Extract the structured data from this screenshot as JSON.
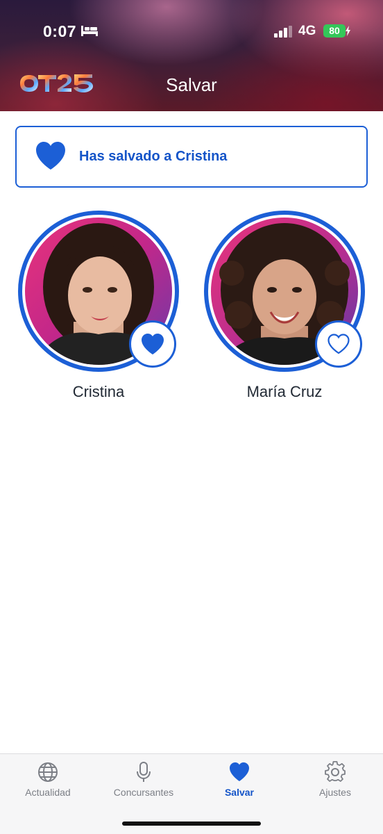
{
  "status_bar": {
    "time": "0:07",
    "network": "4G",
    "battery": "80",
    "icons": [
      "bed-icon",
      "cellular-signal-icon",
      "battery-charging-icon"
    ]
  },
  "header": {
    "logo_text": "OT25",
    "title": "Salvar"
  },
  "notice": {
    "icon": "heart-filled-icon",
    "text": "Has salvado a Cristina"
  },
  "contestants": [
    {
      "name": "Cristina",
      "saved": true,
      "icon": "heart-filled-icon"
    },
    {
      "name": "María Cruz",
      "saved": false,
      "icon": "heart-outline-icon"
    }
  ],
  "tabbar": {
    "tabs": [
      {
        "label": "Actualidad",
        "icon": "globe-icon",
        "active": false
      },
      {
        "label": "Concursantes",
        "icon": "microphone-icon",
        "active": false
      },
      {
        "label": "Salvar",
        "icon": "heart-filled-icon",
        "active": true
      },
      {
        "label": "Ajustes",
        "icon": "gear-icon",
        "active": false
      }
    ]
  },
  "colors": {
    "accent": "#1c5fd6",
    "accent_text": "#1454c8",
    "tab_inactive": "#7c7f86",
    "battery": "#34c759"
  }
}
